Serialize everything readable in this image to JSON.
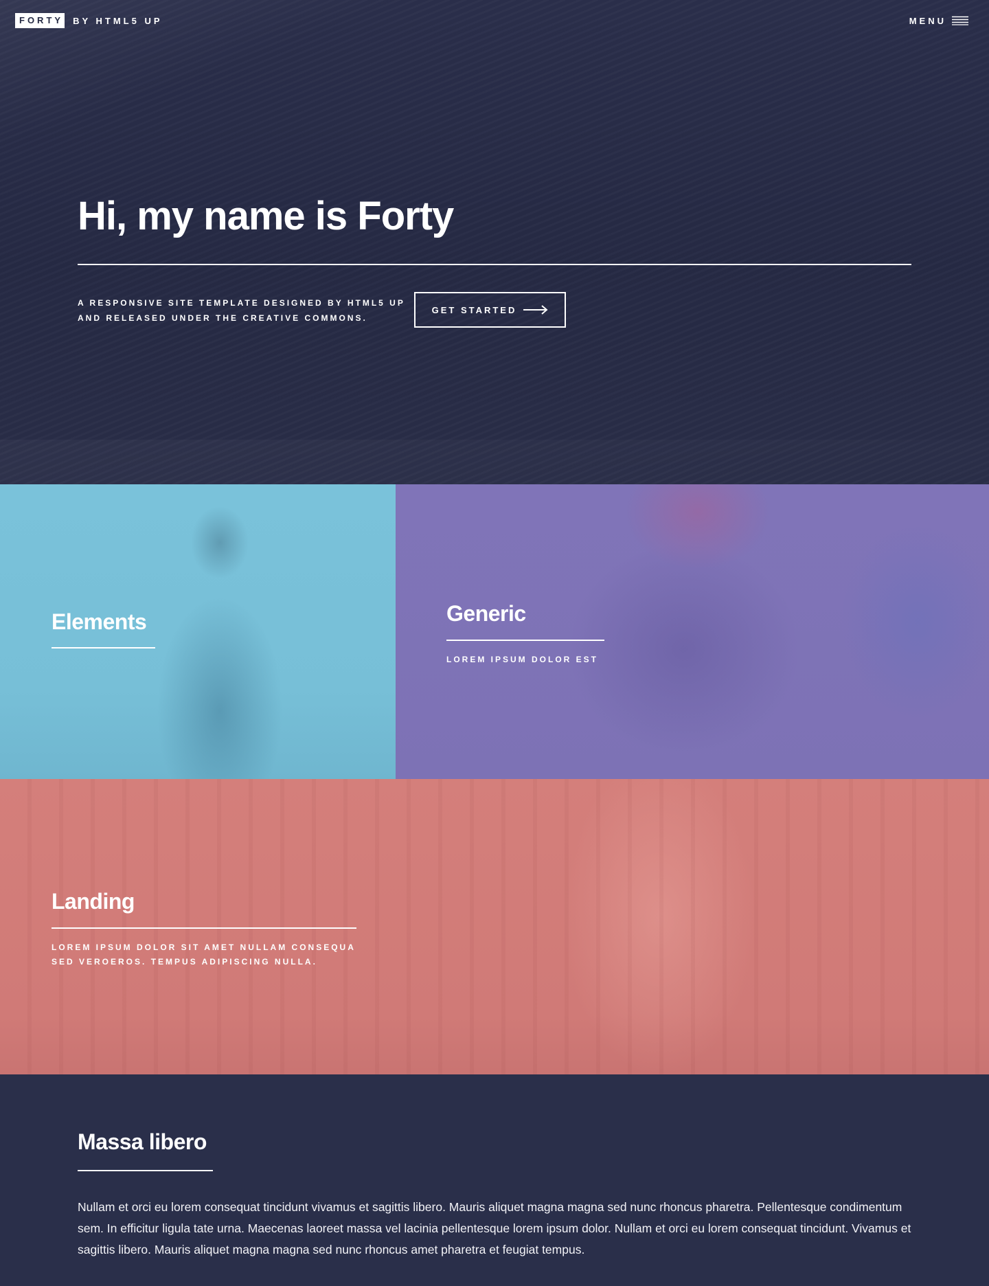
{
  "header": {
    "logo_box": "FORTY",
    "logo_by": "BY HTML5 UP",
    "menu_label": "MENU",
    "menu_icon": "hamburger-icon"
  },
  "banner": {
    "title": "Hi, my name is Forty",
    "tagline_line1": "A RESPONSIVE SITE TEMPLATE DESIGNED BY HTML5 UP",
    "tagline_line2": "AND RELEASED UNDER THE CREATIVE COMMONS.",
    "button_label": "GET STARTED",
    "button_icon": "arrow-right-icon"
  },
  "tiles": [
    {
      "title": "Elements",
      "subtitle": "",
      "color": "#7ac2da"
    },
    {
      "title": "Generic",
      "subtitle": "LOREM IPSUM DOLOR EST",
      "color": "#8074b8"
    },
    {
      "title": "Landing",
      "subtitle_line1": "LOREM IPSUM DOLOR SIT AMET NULLAM CONSEQUA",
      "subtitle_line2": "SED VEROEROS. TEMPUS ADIPISCING NULLA.",
      "color": "#d47f7b"
    }
  ],
  "main": {
    "title": "Massa libero",
    "text": "Nullam et orci eu lorem consequat tincidunt vivamus et sagittis libero. Mauris aliquet magna magna sed nunc rhoncus pharetra. Pellentesque condimentum sem. In efficitur ligula tate urna. Maecenas laoreet massa vel lacinia pellentesque lorem ipsum dolor. Nullam et orci eu lorem consequat tincidunt. Vivamus et sagittis libero. Mauris aliquet magna magna sed nunc rhoncus amet pharetra et feugiat tempus."
  },
  "colors": {
    "background": "#2a2f4a",
    "text": "#ffffff"
  }
}
